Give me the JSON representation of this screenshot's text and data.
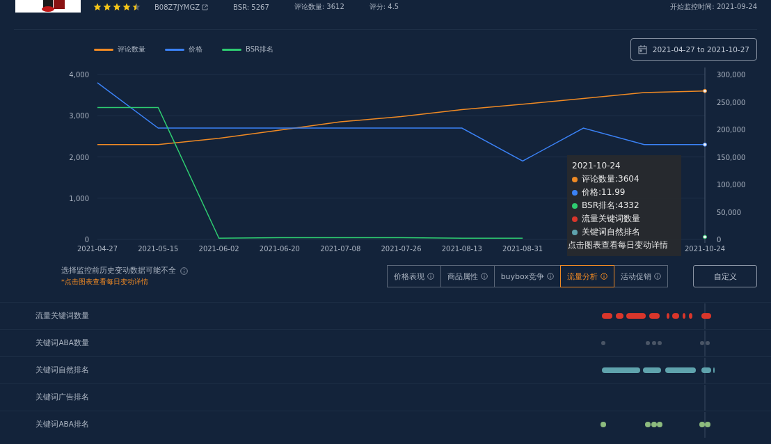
{
  "header": {
    "asin": "B08Z7JYMGZ",
    "bsr": "BSR: 5267",
    "reviews": "评论数量: 3612",
    "rating": "评分: 4.5",
    "stars": 4.5,
    "monitor_start": "开始监控时间: 2021-09-24"
  },
  "chart": {
    "date_range": "2021-04-27 to 2021-10-27",
    "right_axis_labels": [
      "300,000",
      "250,000",
      "200,000",
      "150,000",
      "100,000",
      "50,000",
      "0"
    ],
    "chart_data": {
      "type": "line",
      "grid": true,
      "categories": [
        "2021-04-27",
        "2021-05-15",
        "2021-06-02",
        "2021-06-20",
        "2021-07-08",
        "2021-07-26",
        "2021-08-13",
        "2021-08-31",
        null,
        null,
        "2021-10-24"
      ],
      "series": [
        {
          "name": "评论数量",
          "color": "#f08a24",
          "values": [
            2300,
            2300,
            2450,
            2650,
            2850,
            2980,
            3150,
            3280,
            3420,
            3560,
            3600
          ]
        },
        {
          "name": "价格",
          "color": "#3b82f6",
          "values": [
            3800,
            2700,
            2700,
            2700,
            2700,
            2700,
            2700,
            1900,
            2700,
            2300,
            2300
          ]
        },
        {
          "name": "BSR排名",
          "color": "#2ecc71",
          "values": [
            3200,
            3200,
            30,
            40,
            40,
            40,
            30,
            30,
            null,
            null,
            60
          ]
        }
      ],
      "ylim": [
        0,
        4000
      ],
      "yticks": [
        {
          "value": 0,
          "label": "0"
        },
        {
          "value": 1000,
          "label": "1,000"
        },
        {
          "value": 2000,
          "label": "2,000"
        },
        {
          "value": 3000,
          "label": "3,000"
        },
        {
          "value": 4000,
          "label": "4,000"
        }
      ]
    },
    "tooltip": {
      "date": "2021-10-24",
      "items": [
        {
          "text": "评论数量:3604",
          "color": "#f08a24"
        },
        {
          "text": "价格:11.99",
          "color": "#3b82f6"
        },
        {
          "text": "BSR排名:4332",
          "color": "#2ecc71"
        },
        {
          "text": "流量关键词数量",
          "color": "#d9362b"
        },
        {
          "text": "关键词自然排名",
          "color": "#5fa3ad"
        }
      ],
      "hint": "点击图表查看每日变动详情"
    }
  },
  "notice": "选择监控前历史变动数据可能不全",
  "notice_hint": "*点击图表查看每日变动详情",
  "tabs": [
    {
      "label": "价格表现",
      "selected": false
    },
    {
      "label": "商品属性",
      "selected": false
    },
    {
      "label": "buybox竞争",
      "selected": false
    },
    {
      "label": "流量分析",
      "selected": true
    },
    {
      "label": "活动促销",
      "selected": false
    }
  ],
  "custom_button": "自定义",
  "rows": [
    {
      "label": "流量关键词数量",
      "kind": "bars",
      "color": "#d9362b"
    },
    {
      "label": "关键词ABA数量",
      "kind": "dots",
      "color": "#4a5566"
    },
    {
      "label": "关键词自然排名",
      "kind": "bars",
      "color": "#5fa3ad"
    },
    {
      "label": "关键词广告排名",
      "kind": "none"
    },
    {
      "label": "关键词ABA排名",
      "kind": "dots",
      "color": "#8dbb7e"
    }
  ]
}
